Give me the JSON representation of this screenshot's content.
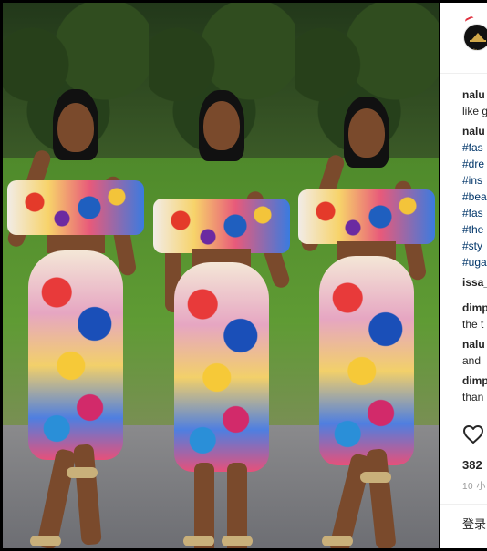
{
  "post": {
    "username": "nalu",
    "avatar_brand": "Nalu",
    "caption_line1": "like g",
    "caption_line2": "nalu",
    "hashtags": [
      "#fas",
      "#dre",
      "#ins",
      "#bea",
      "#fas",
      "#the",
      "#sty",
      "#uga"
    ],
    "comments": [
      {
        "user": "issa_",
        "text": ""
      },
      {
        "user": "dimp",
        "text": "the t"
      },
      {
        "user": "nalu",
        "text": "and"
      },
      {
        "user": "dimp",
        "text": "than"
      }
    ],
    "likes": "382",
    "time": "10 小",
    "login_label": "登录"
  },
  "colors": {
    "accent_red": "#e0313f",
    "link_blue": "#003569",
    "text": "#262626",
    "muted": "#999999"
  },
  "icons": {
    "like": "heart-icon",
    "logo": "crown-logo-icon"
  }
}
